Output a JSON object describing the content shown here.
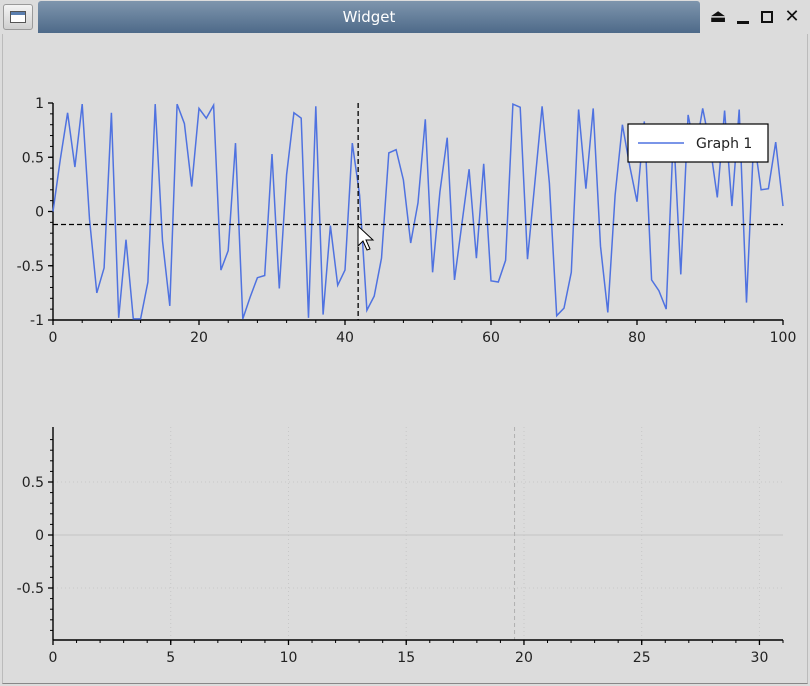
{
  "window": {
    "title": "Widget",
    "controls": [
      "eject-icon",
      "minimize-icon",
      "maximize-icon",
      "close-icon"
    ]
  },
  "chart_data": [
    {
      "type": "line",
      "title": "",
      "xlabel": "",
      "ylabel": "",
      "xlim": [
        0,
        100
      ],
      "ylim": [
        -1,
        1
      ],
      "x_ticks": [
        "0",
        "20",
        "40",
        "60",
        "80",
        "100"
      ],
      "y_ticks": [
        "1",
        "0.5",
        "0",
        "-0.5",
        "-1"
      ],
      "legend_position": "top-right",
      "series": [
        {
          "name": "Graph 1",
          "color": "#4f72e0",
          "formula_points": "y = sin(x^2/2) sampled at integer x 0..100",
          "x": [
            0,
            1,
            2,
            3,
            4,
            5,
            6,
            7,
            8,
            9,
            10,
            11,
            12,
            13,
            14,
            15,
            16,
            17,
            18,
            19,
            20,
            21,
            22,
            23,
            24,
            25,
            26,
            27,
            28,
            29,
            30,
            31,
            32,
            33,
            34,
            35,
            36,
            37,
            38,
            39,
            40,
            41,
            42,
            43,
            44,
            45,
            46,
            47,
            48,
            49,
            50,
            51,
            52,
            53,
            54,
            55,
            56,
            57,
            58,
            59,
            60,
            61,
            62,
            63,
            64,
            65,
            66,
            67,
            68,
            69,
            70,
            71,
            72,
            73,
            74,
            75,
            76,
            77,
            78,
            79,
            80,
            81,
            82,
            83,
            84,
            85,
            86,
            87,
            88,
            89,
            90,
            91,
            92,
            93,
            94,
            95,
            96,
            97,
            98,
            99,
            100
          ],
          "y": [
            0,
            0.48,
            0.91,
            0.41,
            0.99,
            -0.07,
            -0.75,
            -0.52,
            0.91,
            -0.98,
            -0.26,
            -0.99,
            -0.99,
            -0.65,
            0.99,
            -0.27,
            -0.87,
            0.99,
            0.81,
            0.23,
            0.95,
            0.86,
            0.98,
            -0.54,
            -0.36,
            0.63,
            -0.99,
            -0.79,
            -0.61,
            -0.59,
            0.53,
            -0.71,
            0.34,
            0.91,
            0.86,
            -0.98,
            0.97,
            -0.95,
            -0.13,
            -0.68,
            -0.54,
            0.63,
            0.15,
            -0.91,
            -0.78,
            -0.43,
            0.54,
            0.57,
            0.29,
            -0.29,
            0.08,
            0.85,
            -0.56,
            0.18,
            0.68,
            -0.63,
            -0.12,
            0.39,
            -0.43,
            0.44,
            -0.64,
            -0.65,
            -0.45,
            0.99,
            0.96,
            -0.44,
            0.26,
            0.97,
            0.26,
            -0.96,
            -0.89,
            -0.56,
            0.94,
            0.21,
            0.95,
            -0.32,
            -0.93,
            0.15,
            0.8,
            0.42,
            0.09,
            0.83,
            -0.63,
            -0.73,
            -0.9,
            0.74,
            -0.58,
            0.89,
            0.55,
            0.95,
            0.61,
            0.13,
            0.93,
            0.05,
            0.94,
            -0.84,
            0.68,
            0.2,
            0.21,
            0.64,
            0.05
          ]
        }
      ],
      "tracer": {
        "x": 41.8,
        "y": -0.12
      }
    },
    {
      "type": "line",
      "title": "",
      "xlabel": "",
      "ylabel": "",
      "xlim": [
        0,
        31
      ],
      "ylim": [
        -1,
        1
      ],
      "x_ticks": [
        "0",
        "5",
        "10",
        "15",
        "20",
        "25",
        "30"
      ],
      "y_ticks": [
        "0.5",
        "0",
        "-0.5"
      ],
      "grid": true,
      "series": [],
      "cursor_x": 19.6
    }
  ]
}
